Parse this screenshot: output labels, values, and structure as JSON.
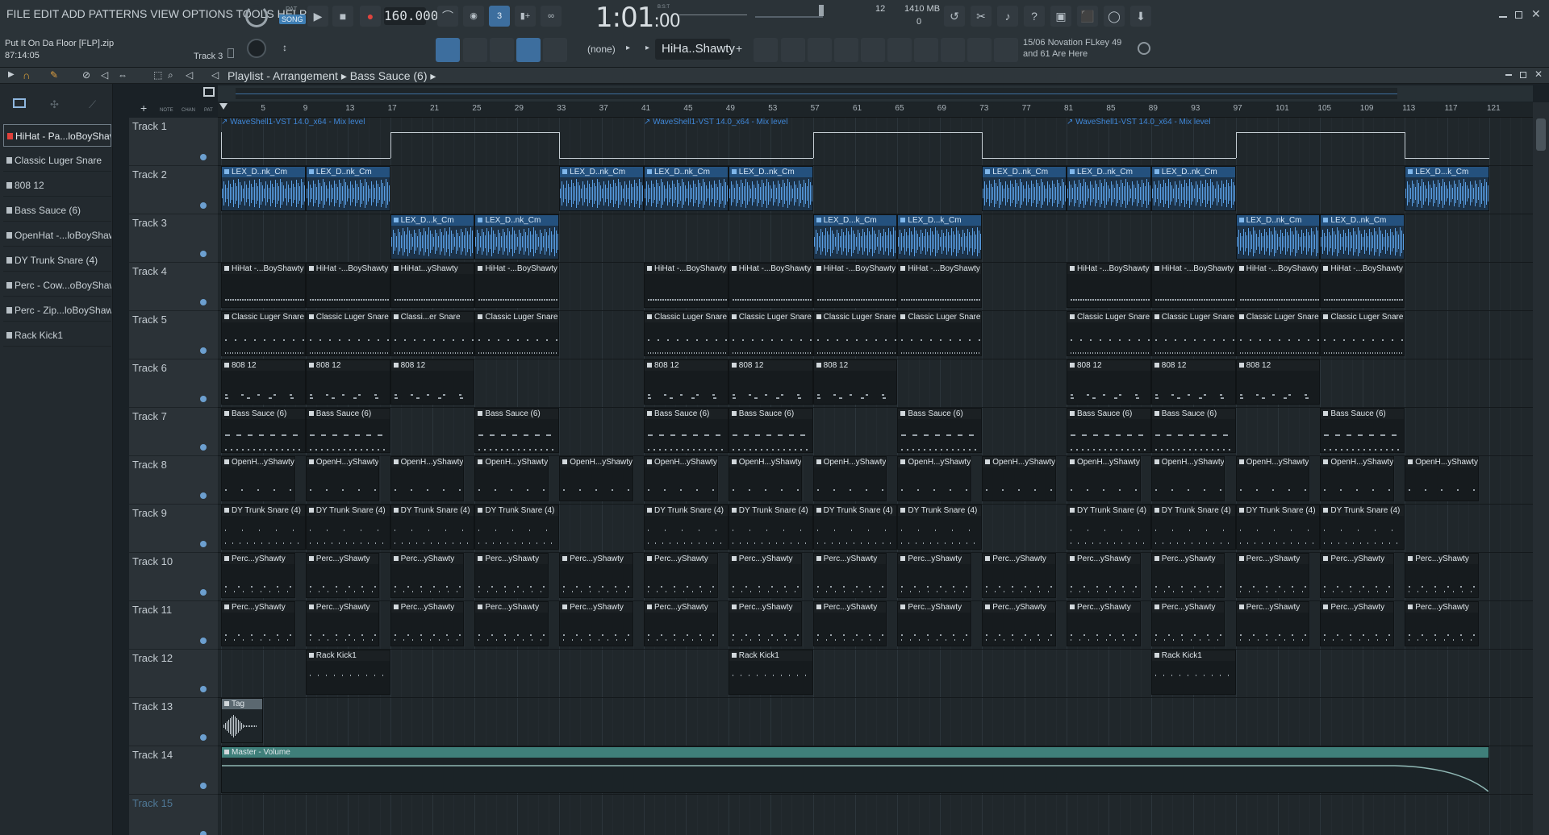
{
  "menu": [
    "FILE",
    "EDIT",
    "ADD",
    "PATTERNS",
    "VIEW",
    "OPTIONS",
    "TOOLS",
    "HELP"
  ],
  "transport": {
    "pat": "PAT",
    "song": "SONG",
    "tempo": "160.000",
    "time": "1:01",
    "time_small": ":00",
    "bst": "B:S:T"
  },
  "project": {
    "name": "Put It On Da Floor [FLP].zip",
    "time": "87:14:05",
    "track_label": "Track 3"
  },
  "stats": {
    "cpu": "12",
    "memory": "1410 MB",
    "poly": "0"
  },
  "pattern_selector": {
    "none_label": "(none)",
    "current": "HiHa..Shawty"
  },
  "hint": {
    "line1": "15/06  Novation FLkey 49",
    "line2": "and 61 Are Here"
  },
  "breadcrumb": {
    "title": "Playlist - Arrangement",
    "pattern": "Bass Sauce (6)"
  },
  "snap_labels": {
    "note": "NOTE",
    "chan": "CHAN",
    "pat": "PAT"
  },
  "patterns": [
    "HiHat - Pa...loBoyShawty",
    "Classic Luger Snare",
    "808 12",
    "Bass Sauce (6)",
    "OpenHat -...loBoyShawty",
    "DY Trunk Snare (4)",
    "Perc - Cow...oBoyShawty",
    "Perc - Zip...loBoyShawty",
    "Rack Kick1"
  ],
  "tracks": [
    "Track 1",
    "Track 2",
    "Track 3",
    "Track 4",
    "Track 5",
    "Track 6",
    "Track 7",
    "Track 8",
    "Track 9",
    "Track 10",
    "Track 11",
    "Track 12",
    "Track 13",
    "Track 14",
    "Track 15"
  ],
  "ruler": [
    "5",
    "9",
    "13",
    "17",
    "21",
    "25",
    "29",
    "33",
    "37",
    "41",
    "45",
    "49",
    "53",
    "57",
    "61",
    "65",
    "69",
    "73",
    "77",
    "81",
    "85",
    "89",
    "93",
    "97",
    "101",
    "105",
    "109",
    "113",
    "117",
    "121"
  ],
  "clips": {
    "automation": "WaveShell1-VST 14.0_x64 - Mix level",
    "audio_a": "LEX_D..nk_Cm",
    "audio_b": "LEX_D...k_Cm",
    "hihat": "HiHat -...BoyShawty",
    "hihat_short": "HiHat...yShawty",
    "snare": "Classic Luger Snare",
    "snare_short": "Classi...er Snare",
    "s808": "808 12",
    "bass": "Bass Sauce (6)",
    "openhat": "OpenH...yShawty",
    "trunk": "DY Trunk Snare (4)",
    "perc": "Perc...yShawty",
    "kick": "Rack Kick1",
    "tag": "Tag",
    "master": "Master - Volume"
  }
}
